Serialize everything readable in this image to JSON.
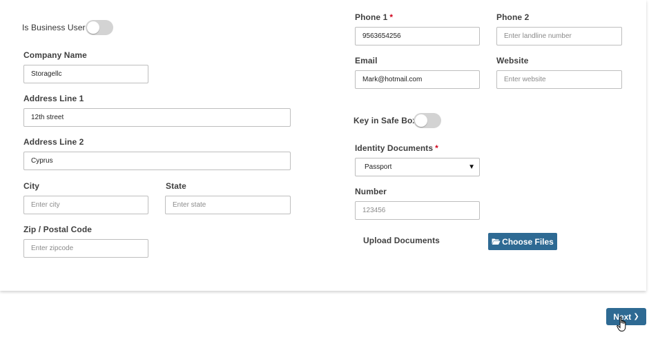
{
  "left": {
    "business_user_label": "Is Business User",
    "company_name": {
      "label": "Company Name",
      "value": "Storagellc",
      "placeholder": ""
    },
    "address1": {
      "label": "Address Line 1",
      "value": "12th street",
      "placeholder": ""
    },
    "address2": {
      "label": "Address Line 2",
      "value": "Cyprus",
      "placeholder": ""
    },
    "city": {
      "label": "City",
      "value": "",
      "placeholder": "Enter city"
    },
    "state": {
      "label": "State",
      "value": "",
      "placeholder": "Enter state"
    },
    "zip": {
      "label": "Zip / Postal Code",
      "value": "",
      "placeholder": "Enter zipcode"
    }
  },
  "right": {
    "phone1": {
      "label": "Phone 1",
      "required_mark": "*",
      "value": "9563654256",
      "placeholder": ""
    },
    "phone2": {
      "label": "Phone 2",
      "value": "",
      "placeholder": "Enter landline number"
    },
    "email": {
      "label": "Email",
      "value": "Mark@hotmail.com",
      "placeholder": ""
    },
    "website": {
      "label": "Website",
      "value": "",
      "placeholder": "Enter website"
    },
    "key_safe_box_label": "Key in Safe Box",
    "identity_documents": {
      "label": "Identity Documents",
      "required_mark": "*",
      "selected": "Passport",
      "arrow": "▼"
    },
    "number": {
      "label": "Number",
      "value": "",
      "placeholder": "123456"
    },
    "upload_label": "Upload Documents",
    "choose_files_label": "Choose Files"
  },
  "footer": {
    "next_label": "Next",
    "next_chevron": "❯"
  },
  "colors": {
    "primary": "#2e6a93",
    "required": "#d0021b",
    "toggle_off": "#d3d3d3"
  }
}
